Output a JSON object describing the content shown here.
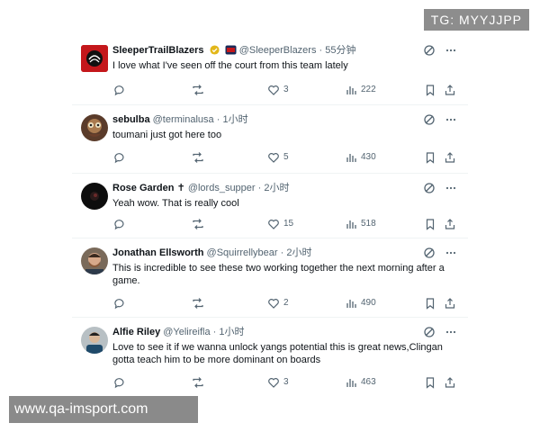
{
  "watermark_top": "TG: MYYJJPP",
  "watermark_bottom": "www.qa-imsport.com",
  "tweets": [
    {
      "name": "SleeperTrailBlazers",
      "handle": "@SleeperBlazers",
      "dot": "·",
      "time": "55分钟",
      "text": "I love what I've seen off the court from this team lately",
      "replies": "",
      "retweets": "",
      "likes": "3",
      "views": "222",
      "avatar_icon": "blazers-logo-icon"
    },
    {
      "name": "sebulba",
      "handle": "@terminalusa",
      "dot": "·",
      "time": "1小时",
      "text": "toumani just got here too",
      "replies": "",
      "retweets": "",
      "likes": "5",
      "views": "430",
      "avatar_icon": "sebulba-avatar-icon"
    },
    {
      "name": "Rose Garden ✝",
      "handle": "@lords_supper",
      "dot": "·",
      "time": "2小时",
      "text": "Yeah wow. That is really cool",
      "replies": "",
      "retweets": "",
      "likes": "15",
      "views": "518",
      "avatar_icon": "rose-garden-avatar-icon"
    },
    {
      "name": "Jonathan Ellsworth",
      "handle": "@Squirrellybear",
      "dot": "·",
      "time": "2小时",
      "text": "This is incredible to see these two working together the next morning after a game.",
      "replies": "",
      "retweets": "",
      "likes": "2",
      "views": "490",
      "avatar_icon": "jonathan-avatar-icon"
    },
    {
      "name": "Alfie Riley",
      "handle": "@Yelireifla",
      "dot": "·",
      "time": "1小时",
      "text": "Love to see it if we wanna unlock yangs potential this is great news,Clingan gotta teach him to be more dominant on boards",
      "replies": "",
      "retweets": "",
      "likes": "3",
      "views": "463",
      "avatar_icon": "alfie-avatar-icon"
    }
  ],
  "colors": {
    "text": "#0f1419",
    "muted": "#536471",
    "divider": "#eff3f4",
    "verified_gold": "#e2b719",
    "blazers_red": "#c4171b"
  }
}
